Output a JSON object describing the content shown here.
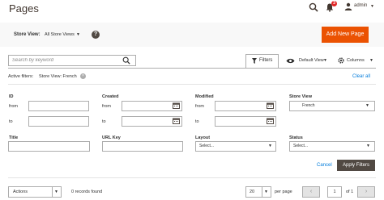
{
  "header": {
    "title": "Pages",
    "notification_count": "3",
    "user_name": "admin"
  },
  "store_switcher": {
    "label": "Store View:",
    "value": "All Store Views"
  },
  "actions": {
    "add_new": "Add New Page"
  },
  "search": {
    "placeholder": "Search by keyword"
  },
  "toolbar": {
    "filters": "Filters",
    "view": "Default View",
    "columns": "Columns"
  },
  "active_filters": {
    "label": "Active filters:",
    "chip": "Store View: French",
    "clear_all": "Clear all"
  },
  "filters": {
    "id": {
      "label": "ID",
      "from": "from",
      "to": "to"
    },
    "created": {
      "label": "Created",
      "from": "from",
      "to": "to"
    },
    "modified": {
      "label": "Modified",
      "from": "from",
      "to": "to"
    },
    "store_view": {
      "label": "Store View",
      "value": "French"
    },
    "title": {
      "label": "Title"
    },
    "url_key": {
      "label": "URL Key"
    },
    "layout": {
      "label": "Layout",
      "value": "Select..."
    },
    "status": {
      "label": "Status",
      "value": "Select..."
    },
    "cancel": "Cancel",
    "apply": "Apply Filters"
  },
  "grid_footer": {
    "mass_actions": "Actions",
    "records": "0 records found",
    "per_page_value": "20",
    "per_page_label": "per page",
    "current_page": "1",
    "of_pages": "of 1"
  },
  "colors": {
    "accent": "#eb5202",
    "link": "#007bdb",
    "dark_button": "#514943",
    "badge": "#e22626"
  },
  "icons": [
    "search-icon",
    "bell-icon",
    "user-icon",
    "help-icon",
    "filter-icon",
    "eye-icon",
    "gear-icon",
    "calendar-icon",
    "chevron-left-icon",
    "chevron-right-icon"
  ]
}
